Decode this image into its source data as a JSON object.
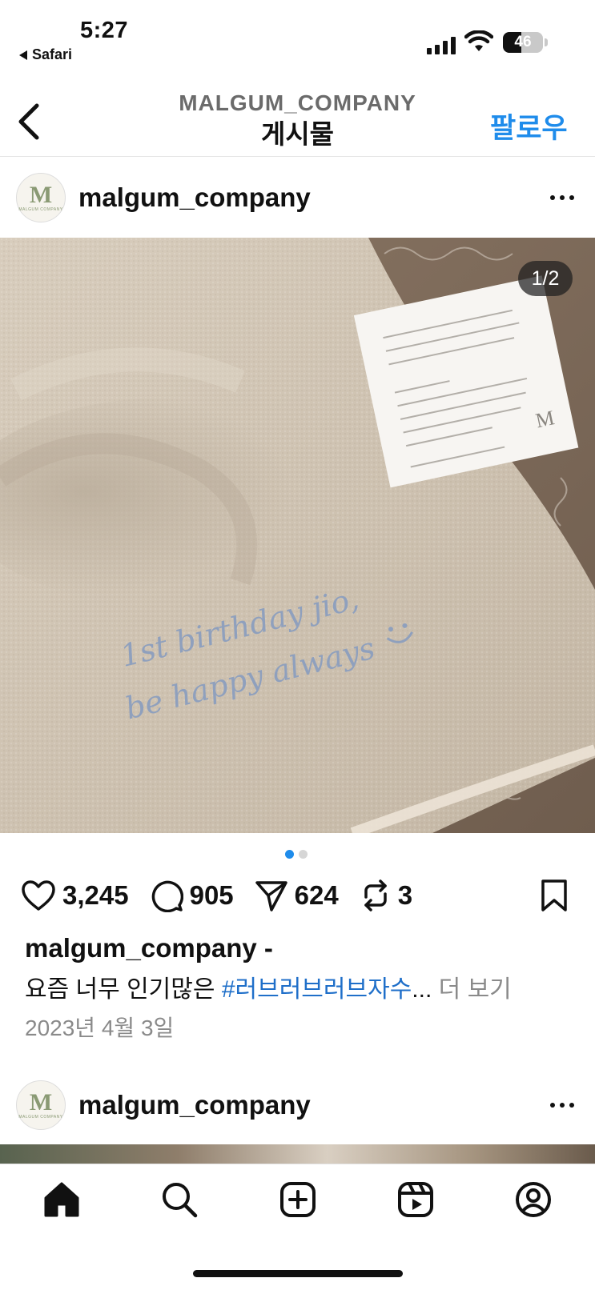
{
  "status_bar": {
    "time": "5:27",
    "back_app": "Safari",
    "battery": "46",
    "battery_fraction": 0.46
  },
  "nav": {
    "account": "MALGUM_COMPANY",
    "title": "게시물",
    "follow": "팔로우"
  },
  "post": {
    "username": "malgum_company",
    "avatar_letter": "M",
    "avatar_small": "MALGUM COMPANY",
    "counter": "1/2",
    "image": {
      "embroidery_line1": "1st birthday jio,",
      "embroidery_line2": "be happy always",
      "card_letter": "M"
    },
    "carousel": {
      "total": 2,
      "active": 1
    },
    "likes": "3,245",
    "comments": "905",
    "shares": "624",
    "reposts": "3",
    "caption_user": "malgum_company -",
    "caption_text": "요즘 너무 인기많은 ",
    "caption_hashtag": "#러브러브러브자수",
    "caption_ellipsis": "...",
    "caption_more": " 더 보기",
    "date": "2023년 4월 3일"
  },
  "next_post": {
    "username": "malgum_company"
  },
  "tabbar": {
    "items": [
      "home-icon",
      "search-icon",
      "create-icon",
      "reels-icon",
      "profile-icon"
    ]
  },
  "colors": {
    "accent": "#1f8ceb",
    "hashtag": "#1f6fc9",
    "dot_active": "#1f8ceb",
    "dot_inactive": "#d6d6d6"
  }
}
